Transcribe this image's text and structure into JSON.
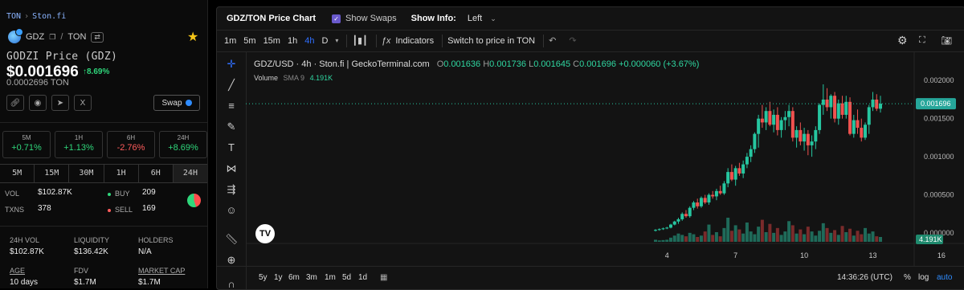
{
  "breadcrumb": {
    "root": "TON",
    "current": "Ston.fi"
  },
  "token": {
    "base": "GDZ",
    "quote": "TON",
    "full_name": "GODZI Price (GDZ)",
    "price_usd": "$0.001696",
    "change": "8.69%",
    "price_ton": "0.0002696 TON",
    "swap_label": "Swap"
  },
  "changes": [
    {
      "label": "5M",
      "value": "+0.71%",
      "positive": true
    },
    {
      "label": "1H",
      "value": "+1.13%",
      "positive": true
    },
    {
      "label": "6H",
      "value": "-2.76%",
      "positive": false
    },
    {
      "label": "24H",
      "value": "+8.69%",
      "positive": true
    }
  ],
  "timeframes": [
    "5M",
    "15M",
    "30M",
    "1H",
    "6H",
    "24H"
  ],
  "trades": {
    "vol_label": "VOL",
    "vol": "$102.87K",
    "txns_label": "TXNS",
    "txns": "378",
    "buy_label": "BUY",
    "buy": "209",
    "sell_label": "SELL",
    "sell": "169",
    "buy_ratio": 0.553
  },
  "stats": {
    "vol24_label": "24H VOL",
    "vol24": "$102.87K",
    "liq_label": "LIQUIDITY",
    "liq": "$136.42K",
    "holders_label": "HOLDERS",
    "holders": "N/A",
    "age_label": "AGE",
    "age": "10 days",
    "fdv_label": "FDV",
    "fdv": "$1.7M",
    "mcap_label": "MARKET CAP",
    "mcap": "$1.7M"
  },
  "chart_header": {
    "title": "GDZ/TON Price Chart",
    "show_swaps": "Show Swaps",
    "show_info_label": "Show Info:",
    "show_info_value": "Left"
  },
  "toolbar": {
    "intervals": [
      "1m",
      "5m",
      "15m",
      "1h",
      "4h",
      "D"
    ],
    "active_interval": "4h",
    "indicators": "Indicators",
    "switch": "Switch to price in TON"
  },
  "legend": {
    "symbol": "GDZ/USD · 4h · Ston.fi | GeckoTerminal.com",
    "o": "0.001636",
    "h": "0.001736",
    "l": "0.001645",
    "c": "0.001696",
    "chg": "+0.000060 (+3.67%)",
    "vol_label": "Volume",
    "vol_sma": "SMA 9",
    "vol_val": "4.191K"
  },
  "chart_data": {
    "type": "candlestick",
    "y_ticks": [
      "0.002000",
      "0.001500",
      "0.001000",
      "0.000500",
      "0.000000"
    ],
    "x_ticks": [
      "4",
      "7",
      "10",
      "13",
      "16"
    ],
    "last_price_label": "0.001696",
    "last_volume_label": "4.191K",
    "ylim": [
      0,
      0.00215
    ],
    "candles": [
      [
        3e-05,
        5e-05,
        2e-05,
        4e-05
      ],
      [
        4e-05,
        6e-05,
        3e-05,
        5e-05
      ],
      [
        5e-05,
        7e-05,
        4e-05,
        6e-05
      ],
      [
        6e-05,
        8e-05,
        5e-05,
        7e-05
      ],
      [
        7e-05,
        0.00012,
        6e-05,
        0.00011
      ],
      [
        0.00011,
        0.00016,
        0.0001,
        0.00015
      ],
      [
        0.00015,
        0.0002,
        0.00012,
        0.00018
      ],
      [
        0.00018,
        0.00027,
        0.00016,
        0.00025
      ],
      [
        0.00025,
        0.0003,
        0.0002,
        0.00022
      ],
      [
        0.00022,
        0.00035,
        0.0002,
        0.00033
      ],
      [
        0.00033,
        0.00042,
        0.0003,
        0.0004
      ],
      [
        0.0004,
        0.00045,
        0.00032,
        0.00035
      ],
      [
        0.00035,
        0.00048,
        0.00033,
        0.00046
      ],
      [
        0.00046,
        0.0005,
        0.00038,
        0.0004
      ],
      [
        0.0004,
        0.00052,
        0.00037,
        0.0005
      ],
      [
        0.0005,
        0.00055,
        0.00045,
        0.00048
      ],
      [
        0.00048,
        0.00058,
        0.00043,
        0.00055
      ],
      [
        0.00055,
        0.00062,
        0.0005,
        0.00052
      ],
      [
        0.00052,
        0.00068,
        0.0005,
        0.00065
      ],
      [
        0.00065,
        0.00085,
        0.0006,
        0.0008
      ],
      [
        0.0008,
        0.0009,
        0.00068,
        0.0007
      ],
      [
        0.0007,
        0.00088,
        0.00062,
        0.00085
      ],
      [
        0.00085,
        0.00092,
        0.00075,
        0.00078
      ],
      [
        0.00078,
        0.00095,
        0.00072,
        0.0009
      ],
      [
        0.0009,
        0.00105,
        0.00085,
        0.001
      ],
      [
        0.001,
        0.00115,
        0.00093,
        0.0011
      ],
      [
        0.0011,
        0.00132,
        0.00105,
        0.0013
      ],
      [
        0.0013,
        0.00155,
        0.00112,
        0.0015
      ],
      [
        0.0015,
        0.00168,
        0.00138,
        0.00145
      ],
      [
        0.00145,
        0.00165,
        0.00135,
        0.0016
      ],
      [
        0.0016,
        0.00172,
        0.0014,
        0.00142
      ],
      [
        0.00142,
        0.00162,
        0.00132,
        0.00155
      ],
      [
        0.00155,
        0.00165,
        0.00128,
        0.00135
      ],
      [
        0.00135,
        0.00152,
        0.00125,
        0.00148
      ],
      [
        0.00148,
        0.0016,
        0.00135,
        0.00152
      ],
      [
        0.00152,
        0.00168,
        0.0014,
        0.0016
      ],
      [
        0.0016,
        0.00165,
        0.0012,
        0.00125
      ],
      [
        0.00125,
        0.0014,
        0.00112,
        0.00135
      ],
      [
        0.00135,
        0.00145,
        0.00115,
        0.0012
      ],
      [
        0.0012,
        0.00138,
        0.00108,
        0.0013
      ],
      [
        0.0013,
        0.00135,
        0.00102,
        0.00115
      ],
      [
        0.00115,
        0.00128,
        0.001,
        0.0012
      ],
      [
        0.0012,
        0.0014,
        0.0011,
        0.00135
      ],
      [
        0.00135,
        0.0017,
        0.0013,
        0.00168
      ],
      [
        0.00168,
        0.00195,
        0.00155,
        0.00175
      ],
      [
        0.00175,
        0.0019,
        0.0016,
        0.00165
      ],
      [
        0.00165,
        0.00182,
        0.0015,
        0.0018
      ],
      [
        0.0018,
        0.00185,
        0.00145,
        0.0015
      ],
      [
        0.0015,
        0.00175,
        0.00142,
        0.0017
      ],
      [
        0.0017,
        0.0018,
        0.0015,
        0.00155
      ],
      [
        0.00155,
        0.0018,
        0.0015,
        0.00172
      ],
      [
        0.00172,
        0.00178,
        0.00128,
        0.0013
      ],
      [
        0.0013,
        0.00155,
        0.00125,
        0.00148
      ],
      [
        0.00148,
        0.00162,
        0.0013,
        0.00138
      ],
      [
        0.00138,
        0.0015,
        0.0012,
        0.00125
      ],
      [
        0.00125,
        0.00145,
        0.00122,
        0.00142
      ],
      [
        0.00142,
        0.00168,
        0.0013,
        0.00165
      ],
      [
        0.00165,
        0.00185,
        0.0016,
        0.00175
      ],
      [
        0.00175,
        0.00182,
        0.0016,
        0.00163
      ],
      [
        0.00163,
        0.0018,
        0.00158,
        0.001696
      ]
    ],
    "volumes": [
      0.3,
      0.2,
      0.25,
      0.3,
      0.6,
      0.9,
      1.2,
      1.0,
      0.8,
      1.3,
      1.1,
      0.7,
      0.9,
      1.5,
      2.5,
      1.0,
      1.4,
      0.8,
      2.0,
      3.5,
      1.6,
      2.4,
      1.8,
      1.2,
      2.8,
      1.5,
      1.1,
      2.2,
      3.2,
      1.4,
      2.6,
      1.3,
      2.0,
      1.0,
      1.5,
      3.0,
      2.4,
      1.2,
      1.8,
      1.1,
      2.2,
      1.5,
      0.9,
      1.6,
      2.7,
      2.0,
      1.3,
      1.7,
      1.0,
      2.3,
      1.4,
      1.9,
      0.9,
      1.6,
      1.1,
      2.0,
      1.2,
      1.5,
      0.8,
      0.7
    ]
  },
  "bottom": {
    "ranges": [
      "5y",
      "1y",
      "6m",
      "3m",
      "1m",
      "5d",
      "1d"
    ],
    "time": "14:36:26 (UTC)",
    "pct": "%",
    "log": "log",
    "auto": "auto"
  }
}
